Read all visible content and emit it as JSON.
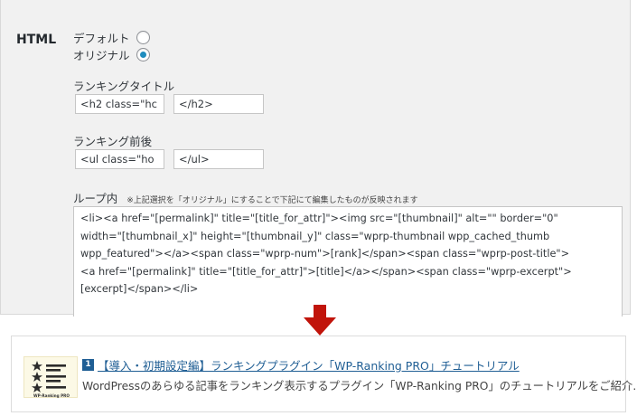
{
  "settings": {
    "section_label": "HTML",
    "radio_default_label": "デフォルト",
    "radio_original_label": "オリジナル",
    "ranking_title_label": "ランキングタイトル",
    "ranking_title_open": "<h2 class=\"hc",
    "ranking_title_close": "</h2>",
    "ranking_before_after_label": "ランキング前後",
    "ranking_wrap_open": "<ul class=\"ho",
    "ranking_wrap_close": "</ul>",
    "loop_label": "ループ内",
    "loop_note": "※上記選択を「オリジナル」にすることで下記にて編集したものが反映されます",
    "loop_template": "<li><a href=\"[permalink]\" title=\"[title_for_attr]\"><img src=\"[thumbnail]\" alt=\"\" border=\"0\"\nwidth=\"[thumbnail_x]\" height=\"[thumbnail_y]\" class=\"wprp-thumbnail wpp_cached_thumb\nwpp_featured\"></a><span class=\"wprp-num\">[rank]</span><span class=\"wprp-post-title\">\n<a href=\"[permalink]\" title=\"[title_for_attr]\">[title]</a></span><span class=\"wprp-excerpt\">\n[excerpt]</span></li>"
  },
  "preview": {
    "rank": "1",
    "title": "【導入・初期設定編】ランキングプラグイン「WP-Ranking PRO」チュートリアル",
    "excerpt": "WordPressのあらゆる記事をランキング表示するプラグイン「WP-Ranking PRO」のチュートリアルをご紹介…",
    "thumb_caption": "WP-Ranking PRO"
  },
  "colors": {
    "accent": "#1e8cbe",
    "arrow": "#c1140b",
    "link": "#1f5e94",
    "thumb_bg": "#fcf9e6"
  }
}
